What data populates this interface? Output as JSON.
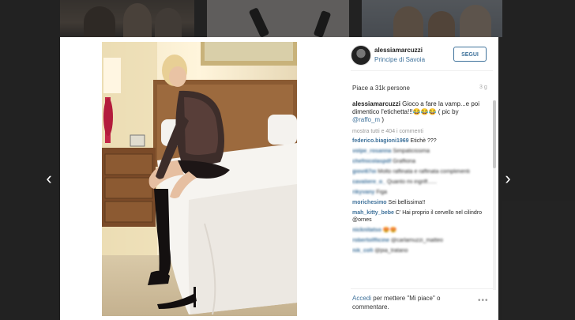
{
  "header": {
    "username": "alessiamarcuzzi",
    "location": "Principe di Savoia",
    "follow_label": "SEGUI"
  },
  "stats": {
    "likes": "Piace a 31k persone",
    "time": "3 g"
  },
  "caption": {
    "username": "alessiamarcuzzi",
    "text": "Gioco a fare la vamp...e poi dimentico l'etichetta!!!😂😂😂 ( pic by ",
    "mention": "@raffo_m",
    "end": " )"
  },
  "view_all": "mostra tutti e 404 i commenti",
  "comments": [
    {
      "user": "federico.biagioni1969",
      "text": "Etichè ???",
      "blur": false
    },
    {
      "user": "volpe_rosanna",
      "text": "Simpaticissima",
      "blur": true
    },
    {
      "user": "chefnicolaspdf",
      "text": "Graffiona",
      "blur": true
    },
    {
      "user": "giovi67oi",
      "text": "Molto raffinata e raffinata complimenti",
      "blur": true
    },
    {
      "user": "cavaliere_o_",
      "text": "Quanto mi ingriff......",
      "blur": true
    },
    {
      "user": "rikyvany",
      "text": "Figa",
      "blur": true
    },
    {
      "user": "morichesimo",
      "text": "Sei bellissima!!",
      "blur": false
    },
    {
      "user": "mah_kitty_bebe",
      "text": "C' Hai proprio il cervello nel cilindro @ornes",
      "blur": false
    },
    {
      "user": "nicknitatso",
      "text": "😍😍",
      "blur": true
    },
    {
      "user": "robertolfficine",
      "text": "@carlamuzzi_matteo",
      "blur": true
    },
    {
      "user": "nik_cofi",
      "text": "@pia_tratano",
      "blur": true
    }
  ],
  "footer": {
    "login_link": "Accedi",
    "login_text": " per mettere \"Mi piace\" o commentare.",
    "more_icon": "ellipsis-icon"
  },
  "navigation": {
    "prev_icon": "chevron-left-icon",
    "next_icon": "chevron-right-icon",
    "prev_glyph": "‹",
    "next_glyph": "›"
  },
  "colors": {
    "accent": "#3f729b",
    "overlay": "#141414"
  }
}
